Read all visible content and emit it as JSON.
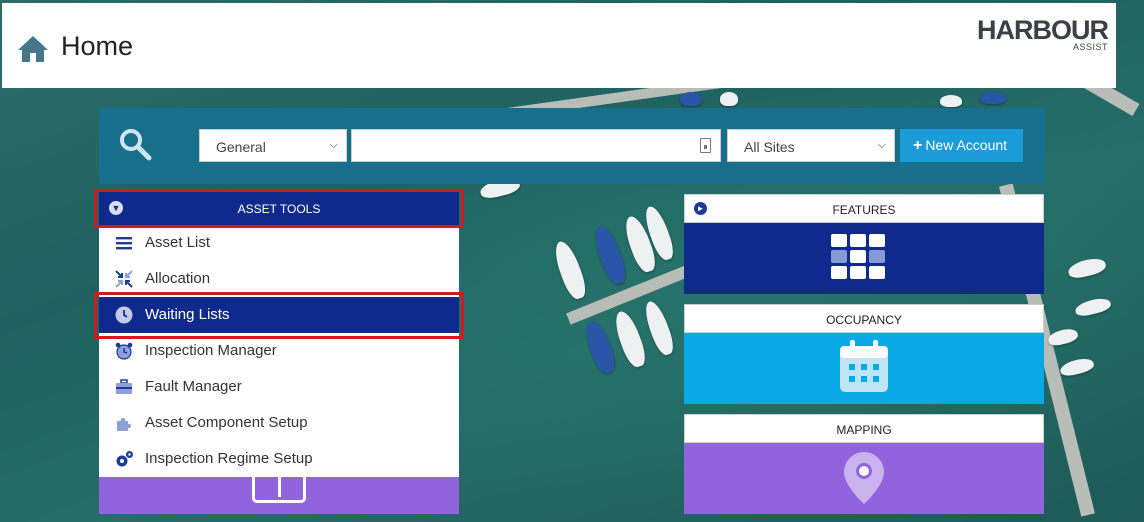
{
  "header": {
    "title": "Home",
    "logo_main": "HARBOUR",
    "logo_sub": "ASSIST"
  },
  "search": {
    "type_selected": "General",
    "input_value": "",
    "sites_selected": "All Sites",
    "new_account_label": "New Account"
  },
  "asset_tools": {
    "header": "ASSET TOOLS",
    "items": [
      {
        "label": "Asset List",
        "icon": "list-icon"
      },
      {
        "label": "Allocation",
        "icon": "allocation-icon"
      },
      {
        "label": "Waiting Lists",
        "icon": "clock-icon",
        "active": true
      },
      {
        "label": "Inspection Manager",
        "icon": "alarm-clock-icon"
      },
      {
        "label": "Fault Manager",
        "icon": "toolbox-icon"
      },
      {
        "label": "Asset Component Setup",
        "icon": "puzzle-icon"
      },
      {
        "label": "Inspection Regime Setup",
        "icon": "gears-icon"
      }
    ]
  },
  "tiles": [
    {
      "title": "FEATURES",
      "icon": "grid-icon",
      "color": "#0f2a8c"
    },
    {
      "title": "OCCUPANCY",
      "icon": "calendar-icon",
      "color": "#09a9e6"
    },
    {
      "title": "MAPPING",
      "icon": "map-marker-icon",
      "color": "#9164de"
    }
  ],
  "colors": {
    "navy": "#0f2a8c",
    "search_bar": "#176f8c",
    "button_blue": "#1b9bd8",
    "purple": "#9164de",
    "highlight_red": "#d11a1a"
  }
}
